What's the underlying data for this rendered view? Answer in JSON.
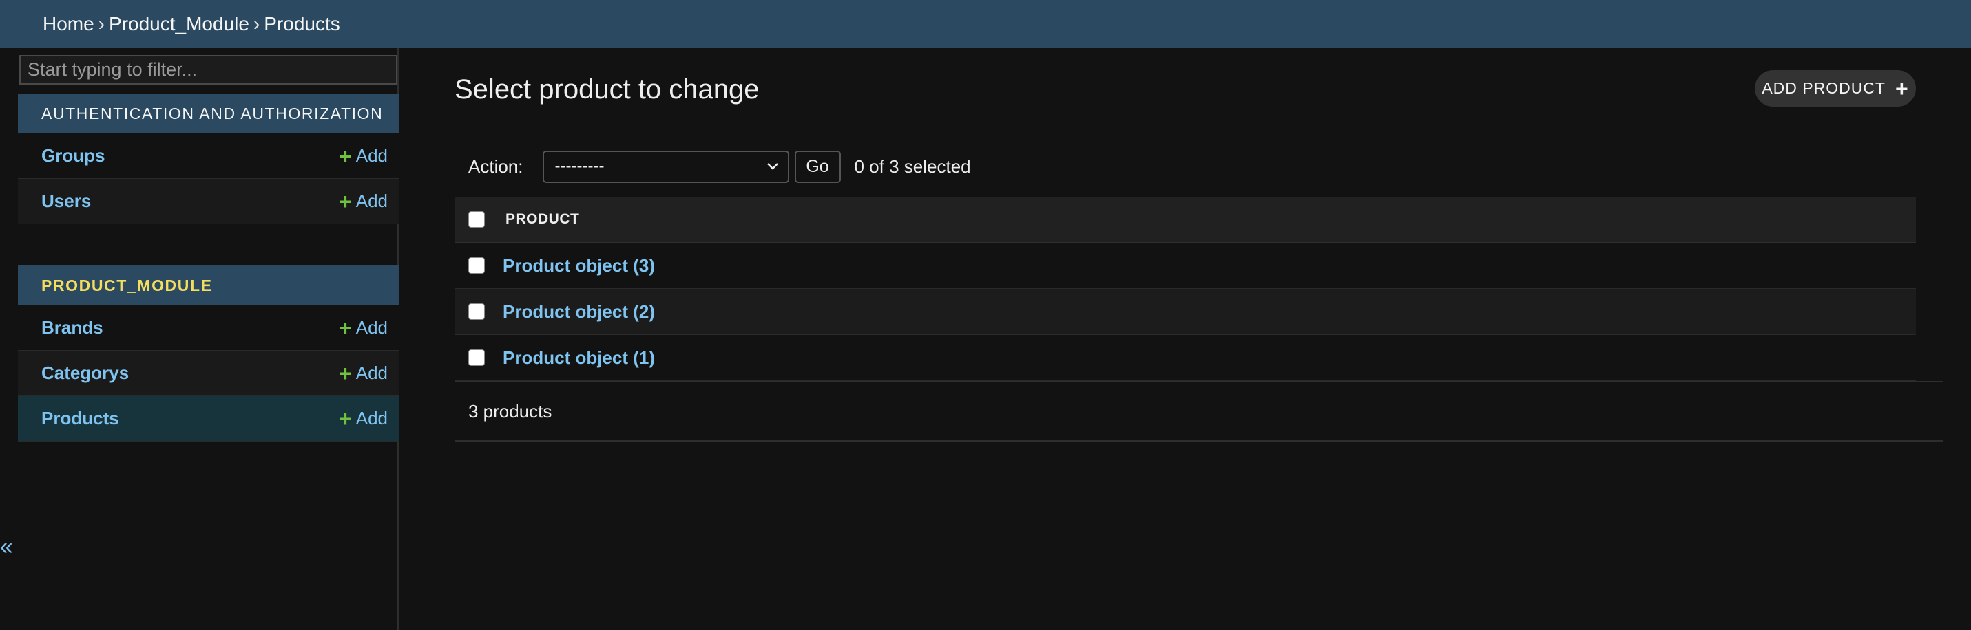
{
  "breadcrumbs": [
    "Home",
    "Product_Module",
    "Products"
  ],
  "breadcrumb_separator": "›",
  "sidebar": {
    "filter_placeholder": "Start typing to filter...",
    "apps": [
      {
        "caption": "AUTHENTICATION AND AUTHORIZATION",
        "models": [
          {
            "name": "Groups",
            "add": "Add"
          },
          {
            "name": "Users",
            "add": "Add"
          }
        ]
      },
      {
        "caption": "PRODUCT_MODULE",
        "models": [
          {
            "name": "Brands",
            "add": "Add"
          },
          {
            "name": "Categorys",
            "add": "Add"
          },
          {
            "name": "Products",
            "add": "Add"
          }
        ]
      }
    ],
    "collapse_glyph": "«"
  },
  "main": {
    "title": "Select product to change",
    "add_button": "ADD PRODUCT",
    "action_label": "Action:",
    "action_value": "---------",
    "go_label": "Go",
    "selected_count": "0 of 3 selected",
    "column_header": "PRODUCT",
    "rows": [
      "Product object (3)",
      "Product object (2)",
      "Product object (1)"
    ],
    "paginator": "3 products"
  },
  "colors": {
    "header_bg": "#2b4a61",
    "link": "#7fc4f0",
    "add_plus": "#6ec23f",
    "active_row": "#17343d",
    "secondary_caption": "#f5dd5d"
  },
  "icons": {
    "add": "plus-icon",
    "dropdown": "chevron-down-icon",
    "collapse": "double-chevron-left-icon"
  }
}
